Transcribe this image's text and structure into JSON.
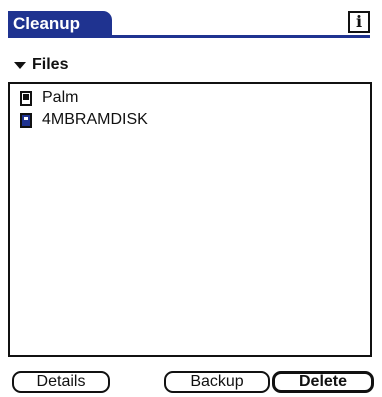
{
  "app": {
    "title": "Cleanup",
    "info_icon": "info-icon",
    "accent_color": "#1f3390"
  },
  "category": {
    "label": "Files",
    "icon": "triangle-down-icon"
  },
  "files": [
    {
      "name": "Palm",
      "icon": "palm-device-icon"
    },
    {
      "name": "4MBRAMDISK",
      "icon": "memory-card-icon"
    }
  ],
  "buttons": {
    "details": "Details",
    "backup": "Backup",
    "delete": "Delete"
  }
}
